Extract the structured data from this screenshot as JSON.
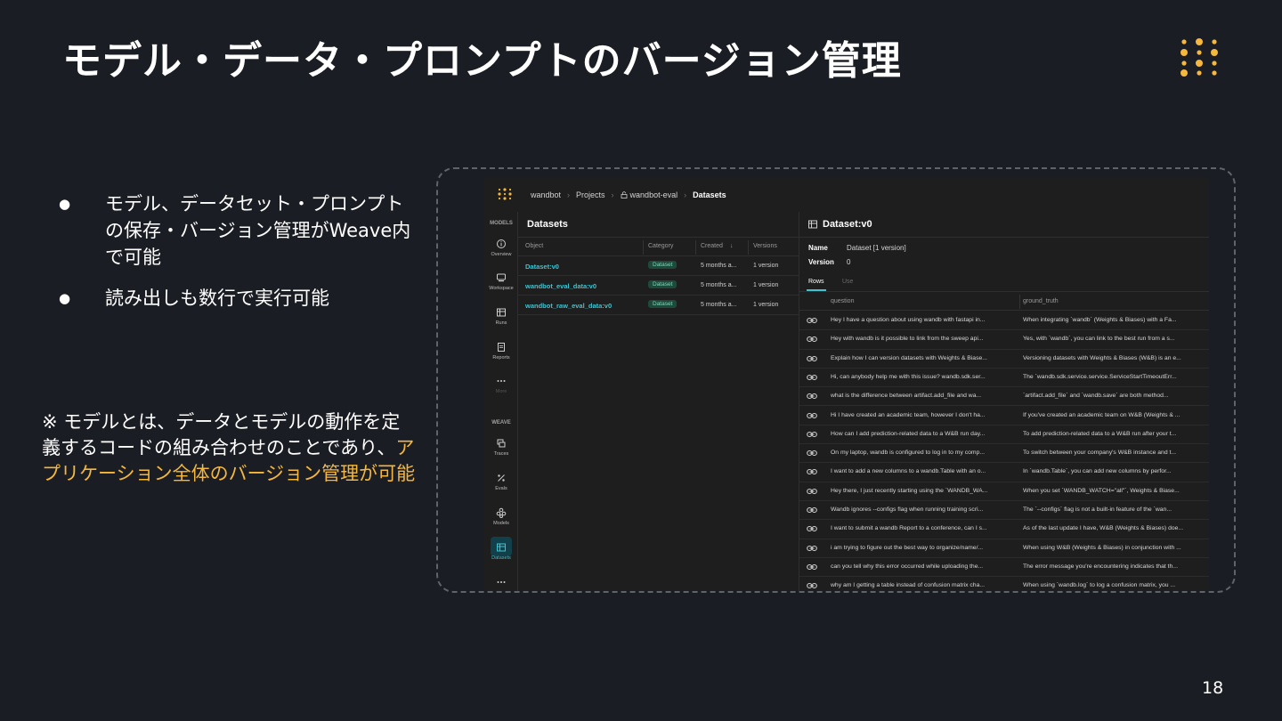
{
  "slide": {
    "title": "モデル・データ・プロンプトのバージョン管理",
    "bullets": [
      "モデル、データセット・プロンプトの保存・バージョン管理がWeave内で可能",
      "読み出しも数行で実行可能"
    ],
    "note_prefix": "※ モデルとは、データとモデルの動作を定義するコードの組み合わせのことであり、",
    "note_highlight": "アプリケーション全体のバージョン管理が可能",
    "page_number": "18",
    "colors": {
      "background": "#1b1d24",
      "highlight": "#f5b83d",
      "accent": "#3fc3d0"
    }
  },
  "app": {
    "breadcrumb": {
      "entity": "wandbot",
      "projects": "Projects",
      "project": "wandbot-eval",
      "current": "Datasets"
    },
    "rail": {
      "models_heading": "MODELS",
      "weave_heading": "WEAVE",
      "models_items": [
        {
          "label": "Overview",
          "icon": "info-icon"
        },
        {
          "label": "Workspace",
          "icon": "workspace-icon"
        },
        {
          "label": "Runs",
          "icon": "table-icon"
        },
        {
          "label": "Reports",
          "icon": "report-icon"
        },
        {
          "label": "More",
          "icon": "more-icon"
        }
      ],
      "weave_items": [
        {
          "label": "Traces",
          "icon": "layers-icon"
        },
        {
          "label": "Evals",
          "icon": "percent-icon"
        },
        {
          "label": "Models",
          "icon": "cube-icon"
        },
        {
          "label": "Datasets",
          "icon": "table-icon"
        }
      ]
    },
    "datasets_panel": {
      "title": "Datasets",
      "columns": {
        "object": "Object",
        "category": "Category",
        "created": "Created",
        "versions": "Versions"
      },
      "rows": [
        {
          "object": "Dataset:v0",
          "category": "Dataset",
          "created": "5 months a...",
          "versions": "1 version"
        },
        {
          "object": "wandbot_eval_data:v0",
          "category": "Dataset",
          "created": "5 months a...",
          "versions": "1 version"
        },
        {
          "object": "wandbot_raw_eval_data:v0",
          "category": "Dataset",
          "created": "5 months a...",
          "versions": "1 version"
        }
      ]
    },
    "detail": {
      "title": "Dataset:v0",
      "name_label": "Name",
      "name_value": "Dataset [1 version]",
      "version_label": "Version",
      "version_value": "0",
      "tabs": {
        "rows": "Rows",
        "use": "Use"
      },
      "columns": {
        "question": "question",
        "ground_truth": "ground_truth"
      },
      "rows": [
        {
          "question": "Hey I have a question about using wandb with fastapi in...",
          "ground_truth": "When integrating `wandb` (Weights & Biases) with a Fa..."
        },
        {
          "question": "Hey with wandb is it possible to link from the sweep api...",
          "ground_truth": "Yes, with `wandb`, you can link to the best run from a s..."
        },
        {
          "question": "Explain how I can version datasets with Weights & Biase...",
          "ground_truth": "Versioning datasets with Weights & Biases (W&B) is an e..."
        },
        {
          "question": "Hi, can anybody help me with this issue? wandb.sdk.ser...",
          "ground_truth": "The `wandb.sdk.service.service.ServiceStartTimeoutErr..."
        },
        {
          "question": "what is the difference between artifact.add_file and wa...",
          "ground_truth": "`artifact.add_file` and `wandb.save` are both method..."
        },
        {
          "question": "Hi I have created an academic team, however I don't ha...",
          "ground_truth": "If you've created an academic team on W&B (Weights & ..."
        },
        {
          "question": "How can I add prediction-related data to a W&B run day...",
          "ground_truth": "To add prediction-related data to a W&B run after your t..."
        },
        {
          "question": "On my laptop, wandb is configured to log in to my comp...",
          "ground_truth": "To switch between your company's W&B instance and t..."
        },
        {
          "question": "I want to add a new columns to a wandb.Table with an o...",
          "ground_truth": "In `wandb.Table`, you can add new columns by perfor..."
        },
        {
          "question": "Hey there, I just recently starting using the `WANDB_WA...",
          "ground_truth": "When you set `WANDB_WATCH=\"all\"`, Weights & Biase..."
        },
        {
          "question": "Wandb ignores --configs flag when running training scri...",
          "ground_truth": "The `--configs` flag is not a built-in feature of the `wan..."
        },
        {
          "question": "I want to submit a wandb Report to a conference, can I s...",
          "ground_truth": "As of the last update I have, W&B (Weights & Biases) doe..."
        },
        {
          "question": "i am trying to figure out the best way to organize/name/...",
          "ground_truth": "When using W&B (Weights & Biases) in conjunction with ..."
        },
        {
          "question": "can you tell why this error occurred while uploading the...",
          "ground_truth": "The error message you're encountering indicates that th..."
        },
        {
          "question": "why am I getting a table instead of confusion matrix cha...",
          "ground_truth": "When using `wandb.log` to log a confusion matrix, you ..."
        }
      ]
    }
  }
}
